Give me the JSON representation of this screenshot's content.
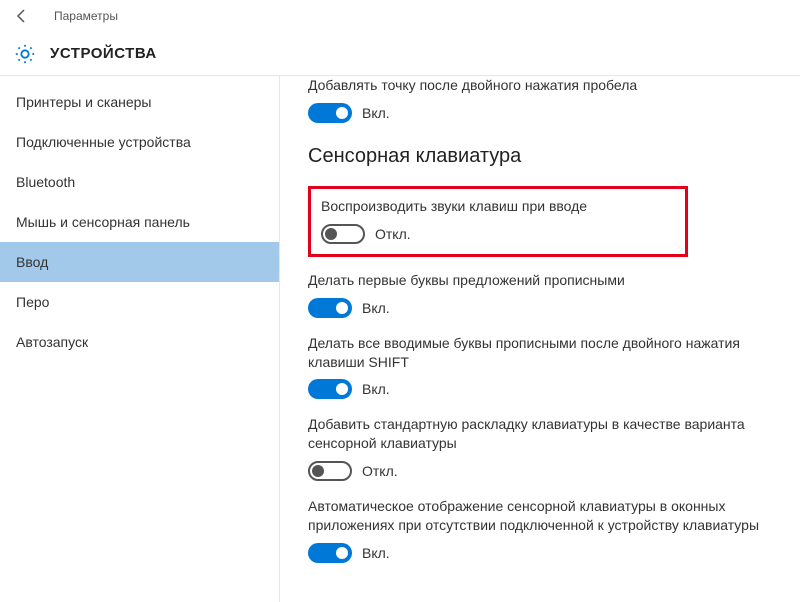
{
  "titlebar": {
    "title": "Параметры"
  },
  "header": {
    "page_title": "УСТРОЙСТВА"
  },
  "sidebar": {
    "items": [
      {
        "label": "Принтеры и сканеры"
      },
      {
        "label": "Подключенные устройства"
      },
      {
        "label": "Bluetooth"
      },
      {
        "label": "Мышь и сенсорная панель"
      },
      {
        "label": "Ввод"
      },
      {
        "label": "Перо"
      },
      {
        "label": "Автозапуск"
      }
    ]
  },
  "content": {
    "truncated_setting": {
      "desc": "Добавлять точку после двойного нажатия пробела",
      "state_label": "Вкл."
    },
    "section_title": "Сенсорная клавиатура",
    "settings": [
      {
        "desc": "Воспроизводить звуки клавиш при вводе",
        "state_label": "Откл.",
        "on": false,
        "highlighted": true
      },
      {
        "desc": "Делать первые буквы предложений прописными",
        "state_label": "Вкл.",
        "on": true
      },
      {
        "desc": "Делать все вводимые буквы прописными после двойного нажатия клавиши SHIFT",
        "state_label": "Вкл.",
        "on": true
      },
      {
        "desc": "Добавить стандартную раскладку клавиатуры в качестве варианта сенсорной клавиатуры",
        "state_label": "Откл.",
        "on": false
      },
      {
        "desc": "Автоматическое отображение сенсорной клавиатуры в оконных приложениях при отсутствии подключенной к устройству клавиатуры",
        "state_label": "Вкл.",
        "on": true
      }
    ]
  }
}
